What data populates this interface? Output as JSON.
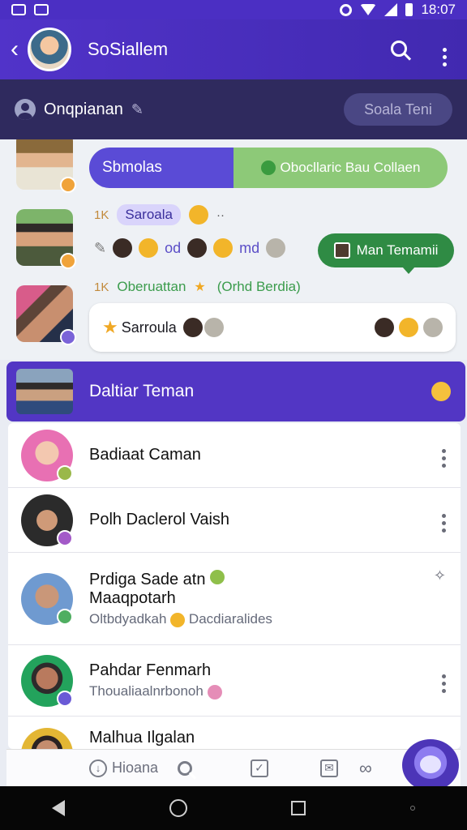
{
  "status": {
    "time": "18:07"
  },
  "appbar": {
    "title": "SoSiallem"
  },
  "subheader": {
    "username": "Onqpianan",
    "button_label": "Soala Teni"
  },
  "chat": {
    "chip_left": "Sbmolas",
    "chip_right": "Obocllaric Bau Collaen",
    "meta1_count": "1K",
    "meta1_tag": "Saroala",
    "meta1_dots": "··",
    "emoji_row_text1": "od",
    "emoji_row_text2": "md",
    "green_pill": "Man Temamii",
    "meta2_count": "1K",
    "meta2_text": "Oberuattan",
    "meta2_tail": "(Orhd Berdia)",
    "bubble_text": "Sarroula"
  },
  "friends": {
    "header_title": "Daltiar Teman",
    "items": [
      {
        "name": "Badiaat Caman",
        "subtitle": ""
      },
      {
        "name": "Polh Daclerol Vaish",
        "subtitle": ""
      },
      {
        "name": "Prdiga Sade atn",
        "name2": "Maaqpotarh",
        "subtitle": "Oltbdyadkah",
        "subtitle2": "Dacdiaralides"
      },
      {
        "name": "Pahdar Fenmarh",
        "subtitle": "Thoualiaalnrbonoh"
      },
      {
        "name": "Malhua Ilgalan",
        "subtitle": ""
      }
    ]
  },
  "bottomnav": {
    "item1": "Hioana"
  },
  "colors": {
    "primary": "#5236c4",
    "accent_green": "#2f8b44",
    "chip_green": "#8dc978"
  }
}
